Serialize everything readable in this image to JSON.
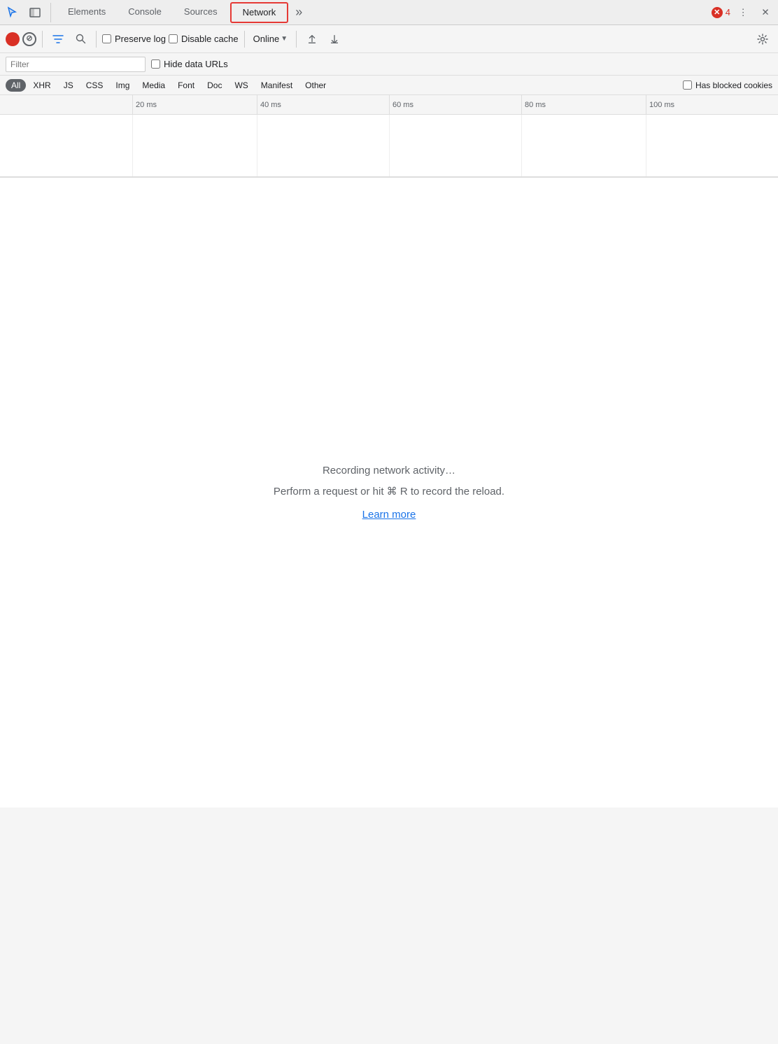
{
  "tabs": {
    "items": [
      {
        "id": "elements",
        "label": "Elements",
        "active": false
      },
      {
        "id": "console",
        "label": "Console",
        "active": false
      },
      {
        "id": "sources",
        "label": "Sources",
        "active": false
      },
      {
        "id": "network",
        "label": "Network",
        "active": true
      }
    ],
    "more_icon": "»",
    "error_count": "4",
    "more_options_label": "⋮",
    "close_label": "✕"
  },
  "toolbar": {
    "record_title": "Stop recording network log",
    "clear_title": "Clear",
    "filter_title": "Filter",
    "search_title": "Search",
    "preserve_log_label": "Preserve log",
    "disable_cache_label": "Disable cache",
    "online_label": "Online",
    "settings_title": "Network settings"
  },
  "filter_bar": {
    "placeholder": "Filter",
    "hide_data_urls_label": "Hide data URLs"
  },
  "type_filters": {
    "items": [
      {
        "id": "all",
        "label": "All",
        "active": true
      },
      {
        "id": "xhr",
        "label": "XHR",
        "active": false
      },
      {
        "id": "js",
        "label": "JS",
        "active": false
      },
      {
        "id": "css",
        "label": "CSS",
        "active": false
      },
      {
        "id": "img",
        "label": "Img",
        "active": false
      },
      {
        "id": "media",
        "label": "Media",
        "active": false
      },
      {
        "id": "font",
        "label": "Font",
        "active": false
      },
      {
        "id": "doc",
        "label": "Doc",
        "active": false
      },
      {
        "id": "ws",
        "label": "WS",
        "active": false
      },
      {
        "id": "manifest",
        "label": "Manifest",
        "active": false
      },
      {
        "id": "other",
        "label": "Other",
        "active": false
      }
    ],
    "has_blocked_cookies_label": "Has blocked cookies"
  },
  "timeline": {
    "ticks": [
      {
        "label": "20 ms",
        "left_percent": 17
      },
      {
        "label": "40 ms",
        "left_percent": 33
      },
      {
        "label": "60 ms",
        "left_percent": 50
      },
      {
        "label": "80 ms",
        "left_percent": 67
      },
      {
        "label": "100 ms",
        "left_percent": 83
      }
    ]
  },
  "main": {
    "recording_text": "Recording network activity…",
    "hint_text": "Perform a request or hit ⌘ R to record the reload.",
    "learn_more_label": "Learn more"
  }
}
